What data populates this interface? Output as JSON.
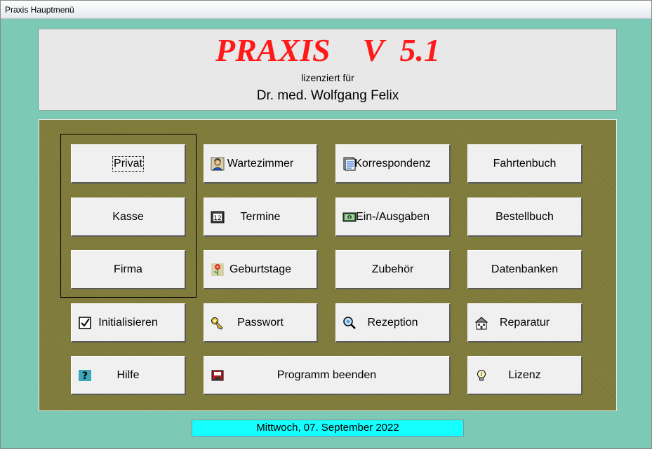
{
  "window": {
    "title": "Praxis Hauptmenü"
  },
  "header": {
    "app_title": "PRAXIS    V  5.1",
    "licensed_label": "lizenziert für",
    "licensee": "Dr. med. Wolfgang Felix"
  },
  "buttons": {
    "privat": "Privat",
    "wartezimmer": "Wartezimmer",
    "korrespondenz": "Korrespondenz",
    "fahrtenbuch": "Fahrtenbuch",
    "kasse": "Kasse",
    "termine": "Termine",
    "ein_ausgaben": "Ein-/Ausgaben",
    "bestellbuch": "Bestellbuch",
    "firma": "Firma",
    "geburtstage": "Geburtstage",
    "zubehoer": "Zubehör",
    "datenbanken": "Datenbanken",
    "initialisieren": "Initialisieren",
    "passwort": "Passwort",
    "rezeption": "Rezeption",
    "reparatur": "Reparatur",
    "hilfe": "Hilfe",
    "programm_beenden": "Programm beenden",
    "lizenz": "Lizenz"
  },
  "icons": {
    "wartezimmer": "person-icon",
    "korrespondenz": "document-icon",
    "termine": "calendar-icon",
    "ein_ausgaben": "money-icon",
    "geburtstage": "flower-icon",
    "initialisieren": "checkbox-icon",
    "passwort": "key-icon",
    "rezeption": "magnifier-icon",
    "reparatur": "building-icon",
    "hilfe": "question-icon",
    "programm_beenden": "exit-icon",
    "lizenz": "lightbulb-icon"
  },
  "colors": {
    "background": "#7cc9b6",
    "title_red": "#ff1a1a",
    "panel_olive": "#84803e",
    "status_cyan": "#16ffff"
  },
  "status": {
    "date": "Mittwoch, 07. September 2022"
  }
}
